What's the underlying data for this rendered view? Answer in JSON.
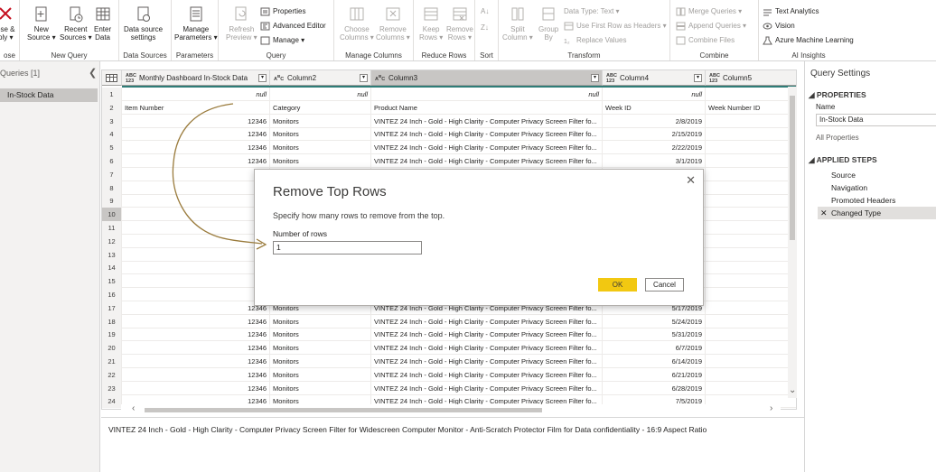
{
  "ribbon": {
    "groups": {
      "close": "ose",
      "new_query": "New Query",
      "data_sources": "Data Sources",
      "parameters": "Parameters",
      "query": "Query",
      "manage_columns": "Manage Columns",
      "reduce_rows": "Reduce Rows",
      "sort": "Sort",
      "transform": "Transform",
      "combine": "Combine",
      "ai": "AI Insights"
    },
    "close_apply": [
      "ose &",
      "ply ▾"
    ],
    "new_source": [
      "New",
      "Source ▾"
    ],
    "recent_sources": [
      "Recent",
      "Sources ▾"
    ],
    "enter_data": [
      "Enter",
      "Data"
    ],
    "data_source_settings": [
      "Data source",
      "settings"
    ],
    "manage_parameters": [
      "Manage",
      "Parameters ▾"
    ],
    "refresh_preview": [
      "Refresh",
      "Preview ▾"
    ],
    "properties": "Properties",
    "advanced_editor": "Advanced Editor",
    "manage": "Manage ▾",
    "choose_columns": [
      "Choose",
      "Columns ▾"
    ],
    "remove_columns": [
      "Remove",
      "Columns ▾"
    ],
    "keep_rows": [
      "Keep",
      "Rows ▾"
    ],
    "remove_rows": [
      "Remove",
      "Rows ▾"
    ],
    "split_column": [
      "Split",
      "Column ▾"
    ],
    "group_by": [
      "Group",
      "By"
    ],
    "data_type": "Data Type: Text ▾",
    "use_first_row": "Use First Row as Headers ▾",
    "replace_values": "Replace Values",
    "merge_queries": "Merge Queries ▾",
    "append_queries": "Append Queries ▾",
    "combine_files": "Combine Files",
    "text_analytics": "Text Analytics",
    "vision": "Vision",
    "azure_ml": "Azure Machine Learning"
  },
  "queries_pane": {
    "title": "Queries [1]",
    "collapse": "❮",
    "item": "In-Stock Data"
  },
  "grid": {
    "columns": [
      {
        "type": "ABC\n123",
        "label": "Monthly Dashboard In-Stock Data"
      },
      {
        "type": "ABC",
        "label": "Column2"
      },
      {
        "type": "ABC",
        "label": "Column3"
      },
      {
        "type": "ABC\n123",
        "label": "Column4"
      },
      {
        "type": "ABC\n123",
        "label": "Column5"
      }
    ],
    "rows": [
      [
        "1",
        "null",
        "null",
        "null",
        "null",
        ""
      ],
      [
        "2",
        "Item Number",
        "Category",
        "Product Name",
        "Week ID",
        "Week Number ID"
      ],
      [
        "3",
        "12346",
        "Monitors",
        "VINTEZ 24 Inch - Gold - High Clarity - Computer Privacy Screen Filter fo...",
        "2/8/2019",
        ""
      ],
      [
        "4",
        "12346",
        "Monitors",
        "VINTEZ 24 Inch - Gold - High Clarity - Computer Privacy Screen Filter fo...",
        "2/15/2019",
        ""
      ],
      [
        "5",
        "12346",
        "Monitors",
        "VINTEZ 24 Inch - Gold - High Clarity - Computer Privacy Screen Filter fo...",
        "2/22/2019",
        ""
      ],
      [
        "6",
        "12346",
        "Monitors",
        "VINTEZ 24 Inch - Gold - High Clarity - Computer Privacy Screen Filter fo...",
        "3/1/2019",
        ""
      ],
      [
        "7",
        "12",
        "",
        "",
        "",
        ""
      ],
      [
        "8",
        "12",
        "",
        "",
        "",
        ""
      ],
      [
        "9",
        "12",
        "",
        "",
        "",
        ""
      ],
      [
        "10",
        "12",
        "",
        "",
        "",
        ""
      ],
      [
        "11",
        "12",
        "",
        "",
        "",
        ""
      ],
      [
        "12",
        "12",
        "",
        "",
        "",
        ""
      ],
      [
        "13",
        "12",
        "",
        "",
        "",
        ""
      ],
      [
        "14",
        "12",
        "",
        "",
        "",
        ""
      ],
      [
        "15",
        "12",
        "",
        "",
        "",
        ""
      ],
      [
        "16",
        "12",
        "",
        "",
        "",
        ""
      ],
      [
        "17",
        "12346",
        "Monitors",
        "VINTEZ 24 Inch - Gold - High Clarity - Computer Privacy Screen Filter fo...",
        "5/17/2019",
        ""
      ],
      [
        "18",
        "12346",
        "Monitors",
        "VINTEZ 24 Inch - Gold - High Clarity - Computer Privacy Screen Filter fo...",
        "5/24/2019",
        ""
      ],
      [
        "19",
        "12346",
        "Monitors",
        "VINTEZ 24 Inch - Gold - High Clarity - Computer Privacy Screen Filter fo...",
        "5/31/2019",
        ""
      ],
      [
        "20",
        "12346",
        "Monitors",
        "VINTEZ 24 Inch - Gold - High Clarity - Computer Privacy Screen Filter fo...",
        "6/7/2019",
        ""
      ],
      [
        "21",
        "12346",
        "Monitors",
        "VINTEZ 24 Inch - Gold - High Clarity - Computer Privacy Screen Filter fo...",
        "6/14/2019",
        ""
      ],
      [
        "22",
        "12346",
        "Monitors",
        "VINTEZ 24 Inch - Gold - High Clarity - Computer Privacy Screen Filter fo...",
        "6/21/2019",
        ""
      ],
      [
        "23",
        "12346",
        "Monitors",
        "VINTEZ 24 Inch - Gold - High Clarity - Computer Privacy Screen Filter fo...",
        "6/28/2019",
        ""
      ],
      [
        "24",
        "12346",
        "Monitors",
        "VINTEZ 24 Inch - Gold - High Clarity - Computer Privacy Screen Filter fo...",
        "7/5/2019",
        ""
      ]
    ]
  },
  "status_text": "VINTEZ 24 Inch - Gold - High Clarity - Computer Privacy Screen Filter for Widescreen Computer Monitor - Anti-Scratch Protector Film for Data confidentiality - 16:9 Aspect Ratio",
  "settings_pane": {
    "title": "Query Settings",
    "properties": "◢ PROPERTIES",
    "name_label": "Name",
    "name_value": "In-Stock Data",
    "all_properties": "All Properties",
    "applied_steps": "◢ APPLIED STEPS",
    "steps": [
      "Source",
      "Navigation",
      "Promoted Headers",
      "Changed Type"
    ]
  },
  "dialog": {
    "title": "Remove Top Rows",
    "close": "✕",
    "subtitle": "Specify how many rows to remove from the top.",
    "field_label": "Number of rows",
    "field_value": "1",
    "ok": "OK",
    "cancel": "Cancel"
  },
  "colors": {
    "accent_yellow": "#f2c811",
    "query_bar": "#2f7d78",
    "annotation": "#9a7b3c"
  }
}
